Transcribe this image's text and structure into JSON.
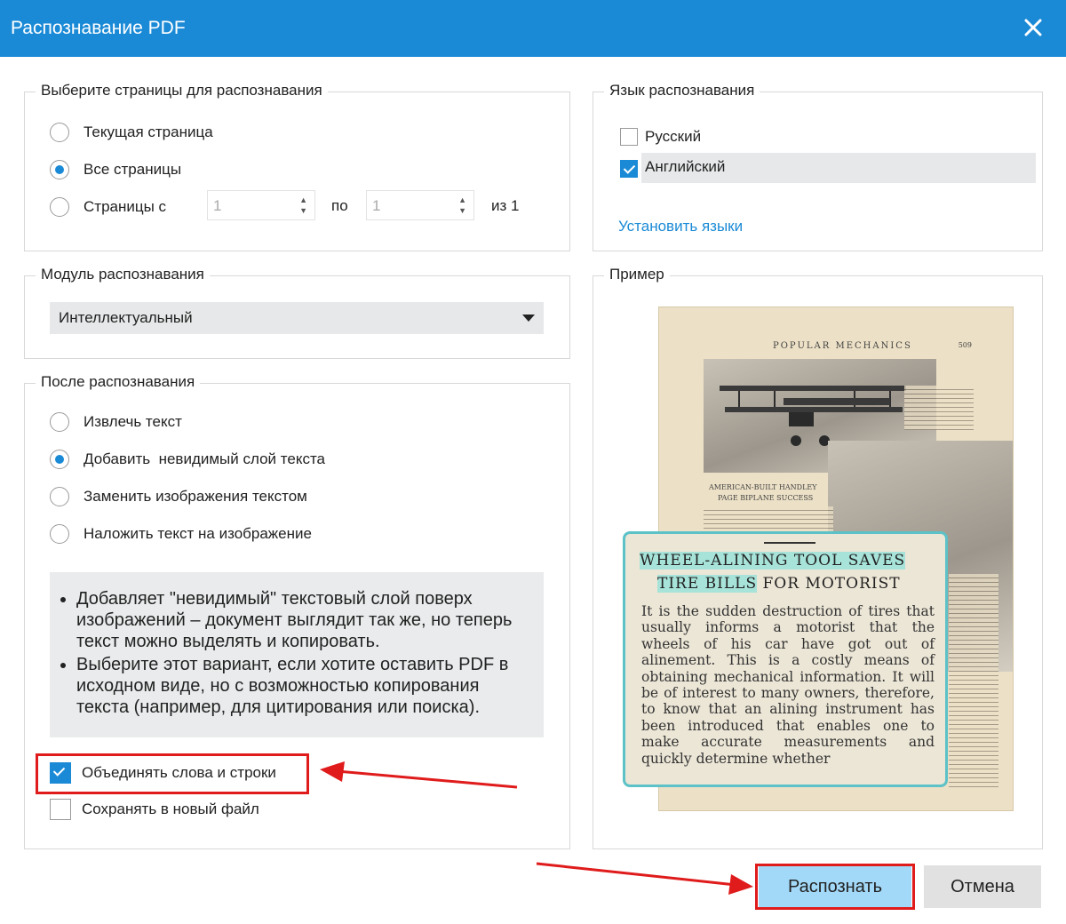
{
  "window": {
    "title": "Распознавание PDF"
  },
  "pages_group": {
    "legend": "Выберите страницы для распознавания",
    "options": [
      "Текущая страница",
      "Все страницы",
      "Страницы с"
    ],
    "selected": "Все страницы",
    "from_value": "1",
    "to_label": "по",
    "to_value": "1",
    "of_label": "из 1"
  },
  "language_group": {
    "legend": "Язык распознавания",
    "languages": [
      {
        "label": "Русский",
        "checked": false
      },
      {
        "label": "Английский",
        "checked": true
      }
    ],
    "install_link": "Установить языки"
  },
  "engine_group": {
    "legend": "Модуль распознавания",
    "selected": "Интеллектуальный"
  },
  "after_group": {
    "legend": "После распознавания",
    "options": [
      "Извлечь текст",
      "Добавить  невидимый слой текста",
      "Заменить изображения текстом",
      "Наложить текст на изображение"
    ],
    "selected": "Добавить  невидимый слой текста",
    "info": [
      "Добавляет \"невидимый\" текстовый слой поверх изображений – документ выглядит так же, но теперь текст можно выделять и копировать.",
      "Выберите этот вариант, если хотите оставить PDF в исходном виде, но с возможностью копирования текста (например, для цитирования или поиска)."
    ],
    "checkboxes": [
      {
        "label": "Объединять слова и строки",
        "checked": true
      },
      {
        "label": "Сохранять в новый файл",
        "checked": false
      }
    ]
  },
  "preview_group": {
    "legend": "Пример",
    "page_header": "POPULAR MECHANICS",
    "page_number": "509",
    "photo_caption_1": "AMERICAN-BUILT HANDLEY",
    "photo_caption_2": "PAGE BIPLANE SUCCESS",
    "zoom_heading_1": "WHEEL-ALINING TOOL SAVES",
    "zoom_heading_2a": "TIRE BILLS",
    "zoom_heading_2b": "FOR MOTORIST",
    "zoom_body": "It is the sudden destruction of tires that usually informs a motorist that the wheels of his car have got out of alinement. This is a costly means of obtaining mechanical information. It will be of interest to many owners, therefore, to know that an alining instrument has been introduced that enables one to make accurate measurements and quickly determine whether"
  },
  "buttons": {
    "recognize": "Распознать",
    "cancel": "Отмена"
  },
  "colors": {
    "accent": "#1b8ad6",
    "highlight_annotation": "#e01b1b",
    "primary_button": "#a3d9f8"
  }
}
